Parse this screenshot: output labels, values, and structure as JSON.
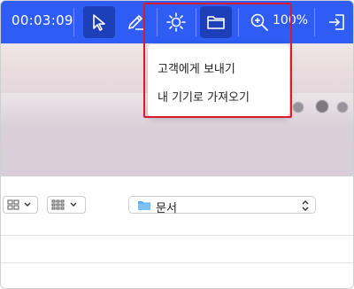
{
  "toolbar": {
    "timer": "00:03:09",
    "zoom": "100%",
    "buttons": [
      "cursor-icon",
      "pencil-icon",
      "brightness-icon",
      "folder-icon",
      "zoom-in-icon",
      "exit-icon"
    ],
    "accent": "#2f5cf4",
    "active_bg": "#1d3fb8"
  },
  "menu": {
    "items": [
      {
        "label": "고객에게 보내기"
      },
      {
        "label": "내 기기로 가져오기"
      }
    ],
    "highlight_color": "#d61c2c"
  },
  "file_panel": {
    "view_options": [
      "grid-view-icon",
      "list-view-icon"
    ],
    "location": "문서"
  }
}
